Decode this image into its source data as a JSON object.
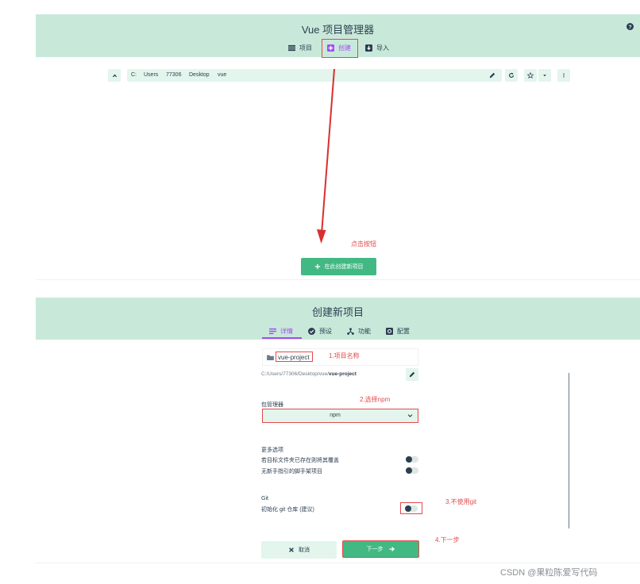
{
  "top_panel": {
    "title": "Vue 项目管理器",
    "tabs": [
      {
        "label": "项目",
        "icon": "list-icon"
      },
      {
        "label": "创建",
        "icon": "plus-square-icon"
      },
      {
        "label": "导入",
        "icon": "import-icon"
      }
    ],
    "help_icon": "help-circle-icon",
    "path_segments": [
      "C:",
      "Users",
      "77306",
      "Desktop",
      "vue"
    ],
    "toolbar_icons": [
      "chevron-up-icon",
      "edit-icon",
      "refresh-icon",
      "star-icon",
      "caret-down-icon",
      "more-vertical-icon"
    ],
    "annotation_click": "点击按钮",
    "create_button": "在此创建新项目"
  },
  "create_panel": {
    "title": "创建新项目",
    "tabs": [
      {
        "label": "详情",
        "icon": "list-icon",
        "active": true
      },
      {
        "label": "预设",
        "icon": "check-circle-icon"
      },
      {
        "label": "功能",
        "icon": "fork-icon"
      },
      {
        "label": "配置",
        "icon": "settings-box-icon"
      }
    ],
    "project_name_value": "vue-project",
    "annotation_name": "1.项目名称",
    "path_prefix": "C:/Users/77306/Desktop/vue/",
    "path_project": "vue-project",
    "package_manager_label": "包管理器",
    "annotation_npm": "2.选择npm",
    "package_manager_value": "npm",
    "more_options_label": "更多选项",
    "options": [
      {
        "label": "若目标文件夹已存在则将其覆盖"
      },
      {
        "label": "无新手指引的脚手架项目"
      }
    ],
    "git_label": "Git",
    "git_option_label": "初始化 git 仓库 (建议)",
    "annotation_git": "3.不使用git",
    "annotation_next": "4.下一步",
    "cancel_label": "取消",
    "next_label": "下一步"
  },
  "watermark": "CSDN @果粒陈爱写代码",
  "colors": {
    "header_bg": "#c8e9da",
    "accent": "#42b983",
    "annotation": "#e34a4a",
    "active_tab": "#a44cf6"
  }
}
